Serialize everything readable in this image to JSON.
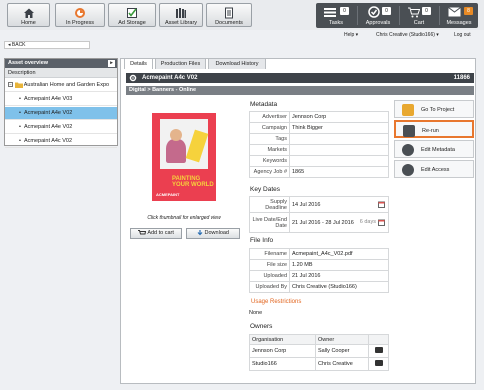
{
  "topnav": {
    "home": "Home",
    "in_progress": "In Progress",
    "ad_storage": "Ad Storage",
    "asset_library": "Asset Library",
    "documents": "Documents"
  },
  "rightnav": {
    "tasks": {
      "label": "Tasks",
      "count": "0"
    },
    "approvals": {
      "label": "Approvals",
      "count": "0"
    },
    "cart": {
      "label": "Cart",
      "count": "0"
    },
    "messages": {
      "label": "Messages",
      "count": "8"
    }
  },
  "menubar": {
    "help": "Help ▾",
    "user": "Chris Creative (Studio166) ▾",
    "logout": "Log out"
  },
  "back": "◂ BACK",
  "asset_overview": {
    "title": "Asset overview",
    "description": "Description",
    "folder": "Australian Home and Garden Expo",
    "items": [
      "Acmepaint A4e V03",
      "Acmepaint A4e V02",
      "Acmepaint A4e V02",
      "Acmepaint A4c V02"
    ]
  },
  "tabs": [
    "Details",
    "Production Files",
    "Download History"
  ],
  "asset": {
    "name": "Acmepaint A4c V02",
    "id": "11866",
    "breadcrumb": "Digital > Banners - Online",
    "thumb_text1": "PAINTING",
    "thumb_text2": "YOUR WORLD",
    "thumb_brand": "ACMEPAINT",
    "thumb_note": "Click thumbnail for enlarged view",
    "add_to_cart": "Add to cart",
    "download": "Download"
  },
  "metadata": {
    "title": "Metadata",
    "rows": [
      {
        "k": "Advertiser",
        "v": "Jennson Corp"
      },
      {
        "k": "Campaign",
        "v": "Think Bigger"
      },
      {
        "k": "Tags",
        "v": ""
      },
      {
        "k": "Markets",
        "v": ""
      },
      {
        "k": "Keywords",
        "v": ""
      },
      {
        "k": "Agency Job #",
        "v": "1865"
      }
    ]
  },
  "key_dates": {
    "title": "Key Dates",
    "supply_label": "Supply Deadline",
    "supply_value": "14 Jul 2016",
    "live_label": "Live Date/End Date",
    "live_value": "21 Jul 2016 - 28 Jul 2016",
    "days": "6 days"
  },
  "file_info": {
    "title": "File Info",
    "rows": [
      {
        "k": "Filename",
        "v": "Acmepaint_A4c_V02.pdf"
      },
      {
        "k": "File size",
        "v": "1.20 MB"
      },
      {
        "k": "Uploaded",
        "v": "21 Jul 2016"
      },
      {
        "k": "Uploaded By",
        "v": "Chris Creative (Studio166)"
      }
    ]
  },
  "usage": {
    "title": "Usage Restrictions",
    "value": "None"
  },
  "owners": {
    "title": "Owners",
    "col_org": "Organisation",
    "col_owner": "Owner",
    "rows": [
      {
        "org": "Jennson Corp",
        "owner": "Sally Cooper"
      },
      {
        "org": "Studio166",
        "owner": "Chris Creative"
      }
    ]
  },
  "actions": [
    "Go To Project",
    "Re-run",
    "Edit Metadata",
    "Edit Access"
  ]
}
